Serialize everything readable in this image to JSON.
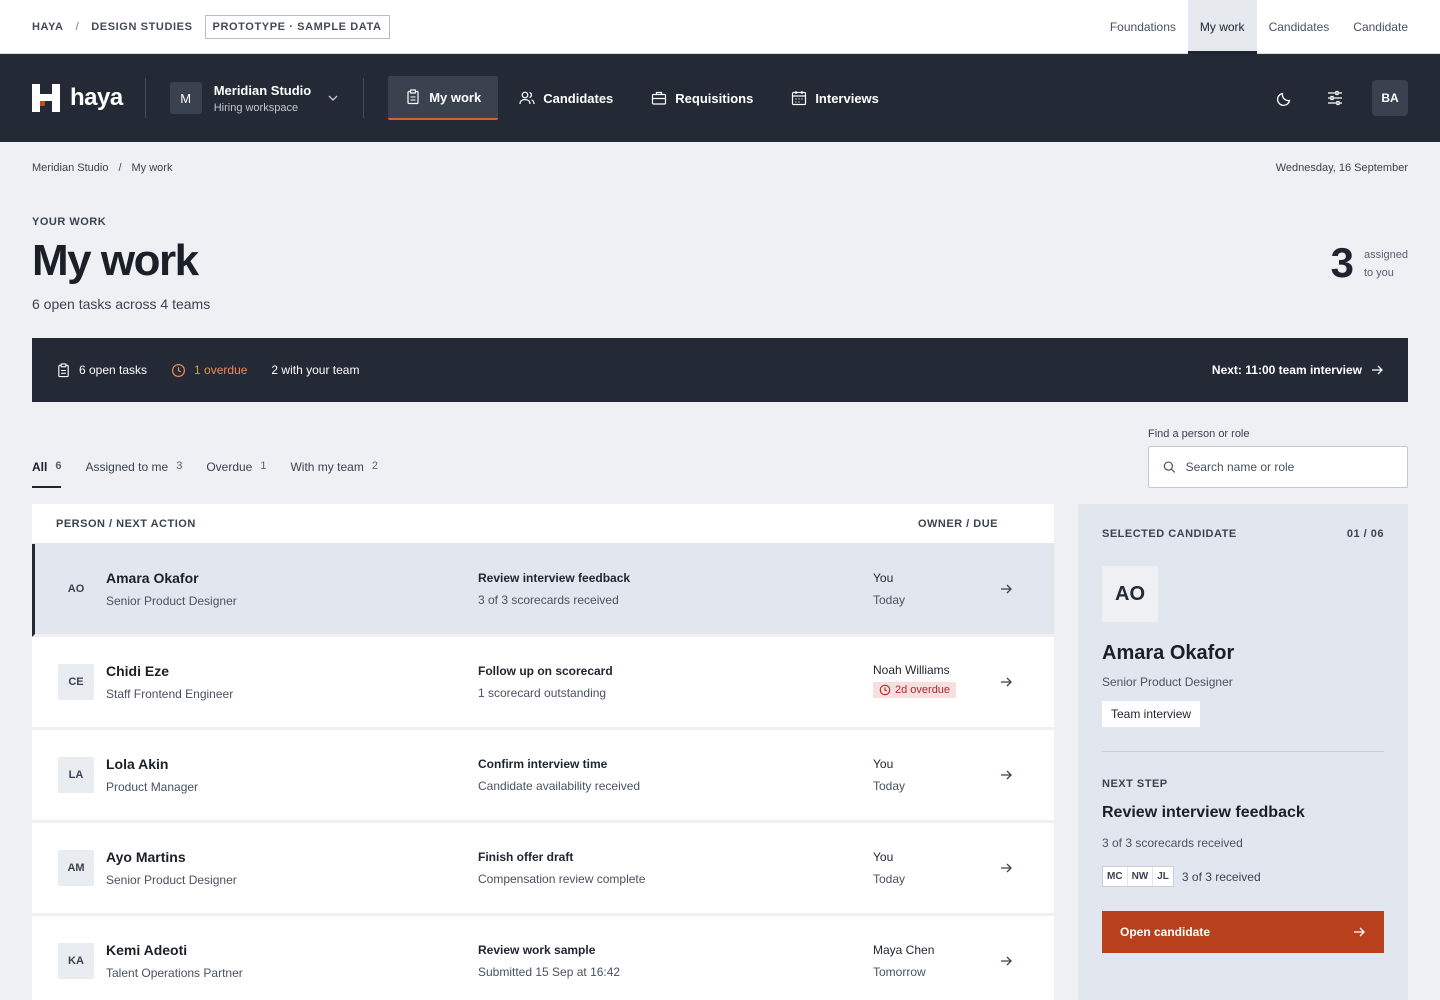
{
  "proto": {
    "crumbs": [
      "HAYA",
      "DESIGN STUDIES"
    ],
    "separator": "/",
    "tag": "PROTOTYPE · SAMPLE DATA",
    "tabs": [
      {
        "label": "Foundations",
        "active": false
      },
      {
        "label": "My work",
        "active": true
      },
      {
        "label": "Candidates",
        "active": false
      },
      {
        "label": "Candidate",
        "active": false
      }
    ]
  },
  "header": {
    "logo_text": "haya",
    "workspace": {
      "initial": "M",
      "name": "Meridian Studio",
      "sub": "Hiring workspace"
    },
    "nav": [
      {
        "label": "My work",
        "icon": "clipboard-icon",
        "active": true
      },
      {
        "label": "Candidates",
        "icon": "people-icon",
        "active": false
      },
      {
        "label": "Requisitions",
        "icon": "briefcase-icon",
        "active": false
      },
      {
        "label": "Interviews",
        "icon": "calendar-icon",
        "active": false
      }
    ],
    "user_initials": "BA",
    "icons": [
      "moon-icon",
      "sliders-icon"
    ]
  },
  "breadcrumb": {
    "items": [
      "Meridian Studio",
      "My work"
    ],
    "separator": "/",
    "date": "Wednesday, 16 September"
  },
  "page": {
    "eyebrow": "YOUR WORK",
    "title": "My work",
    "subtitle": "6 open tasks across 4 teams",
    "assigned_count": "3",
    "assigned_label_1": "assigned",
    "assigned_label_2": "to you"
  },
  "summary": {
    "open_tasks": "6 open tasks",
    "overdue": "1 overdue",
    "with_team": "2 with your team",
    "next": "Next: 11:00 team interview"
  },
  "filters": {
    "tabs": [
      {
        "label": "All",
        "count": "6",
        "active": true
      },
      {
        "label": "Assigned to me",
        "count": "3",
        "active": false
      },
      {
        "label": "Overdue",
        "count": "1",
        "active": false
      },
      {
        "label": "With my team",
        "count": "2",
        "active": false
      }
    ],
    "search_label": "Find a person or role",
    "search_placeholder": "Search name or role"
  },
  "table": {
    "col_person": "PERSON / NEXT ACTION",
    "col_owner": "OWNER / DUE",
    "rows": [
      {
        "initials": "AO",
        "name": "Amara Okafor",
        "role": "Senior Product Designer",
        "action": "Review interview feedback",
        "detail": "3 of 3 scorecards received",
        "owner": "You",
        "due": "Today",
        "overdue": false,
        "selected": true
      },
      {
        "initials": "CE",
        "name": "Chidi Eze",
        "role": "Staff Frontend Engineer",
        "action": "Follow up on scorecard",
        "detail": "1 scorecard outstanding",
        "owner": "Noah Williams",
        "due": "2d overdue",
        "overdue": true,
        "selected": false
      },
      {
        "initials": "LA",
        "name": "Lola Akin",
        "role": "Product Manager",
        "action": "Confirm interview time",
        "detail": "Candidate availability received",
        "owner": "You",
        "due": "Today",
        "overdue": false,
        "selected": false
      },
      {
        "initials": "AM",
        "name": "Ayo Martins",
        "role": "Senior Product Designer",
        "action": "Finish offer draft",
        "detail": "Compensation review complete",
        "owner": "You",
        "due": "Today",
        "overdue": false,
        "selected": false
      },
      {
        "initials": "KA",
        "name": "Kemi Adeoti",
        "role": "Talent Operations Partner",
        "action": "Review work sample",
        "detail": "Submitted 15 Sep at 16:42",
        "owner": "Maya Chen",
        "due": "Tomorrow",
        "overdue": false,
        "selected": false
      }
    ]
  },
  "panel": {
    "eyebrow": "SELECTED CANDIDATE",
    "position": "01 / 06",
    "initials": "AO",
    "name": "Amara Okafor",
    "role": "Senior Product Designer",
    "stage": "Team interview",
    "next_eyebrow": "NEXT STEP",
    "next_title": "Review interview feedback",
    "next_detail": "3 of 3 scorecards received",
    "reviewers": [
      "MC",
      "NW",
      "JL"
    ],
    "reviewers_count": "3 of 3 received",
    "cta": "Open candidate"
  },
  "colors": {
    "accent": "#b8401d",
    "dark": "#232a35",
    "overdue": "#b02a2a"
  }
}
